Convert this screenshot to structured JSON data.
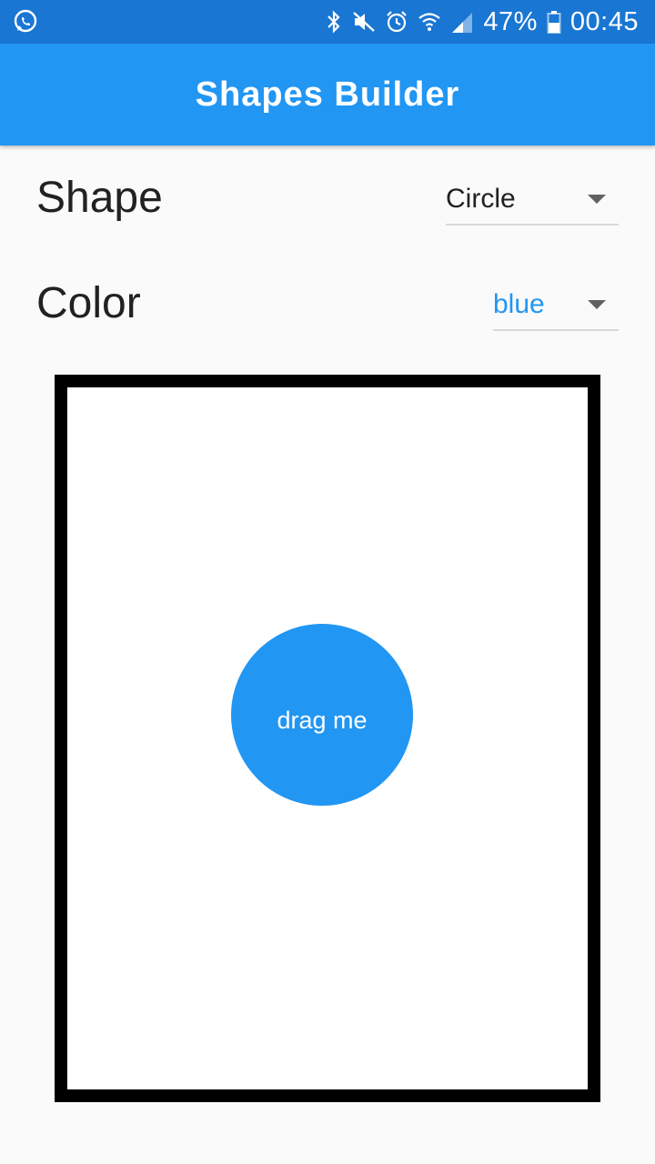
{
  "status_bar": {
    "icons": [
      "whatsapp-icon",
      "bluetooth-icon",
      "mute-icon",
      "alarm-icon",
      "wifi-icon",
      "signal-icon",
      "battery-icon"
    ],
    "battery": "47%",
    "time": "00:45"
  },
  "app_bar": {
    "title": "Shapes Builder",
    "color": "#2196f3"
  },
  "controls": {
    "shape": {
      "label": "Shape",
      "selected": "Circle"
    },
    "color": {
      "label": "Color",
      "selected": "blue"
    }
  },
  "canvas": {
    "shape": {
      "type": "circle",
      "fill": "#2196f3",
      "label": "drag me"
    }
  }
}
